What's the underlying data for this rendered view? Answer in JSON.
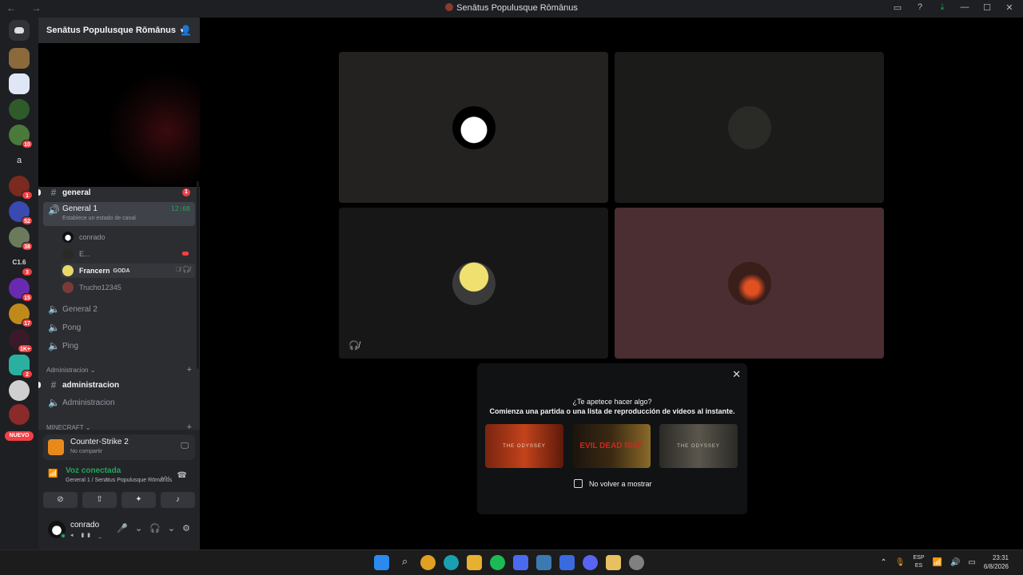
{
  "window": {
    "title": "Senātus Populusque Rōmānus",
    "nav": "← →",
    "controls": [
      "inbox-icon",
      "help-icon",
      "download-icon",
      "minimize-icon",
      "maximize-icon",
      "close-icon"
    ]
  },
  "servers": {
    "badges": [
      "10",
      "1",
      "52",
      "38",
      "3",
      "15",
      "17",
      "1K+",
      "2"
    ],
    "text_icons": [
      "a",
      "C1.6"
    ],
    "new_label": "NUEVO"
  },
  "guild": {
    "name": "Senātus Populusque Rōmānus",
    "channels": {
      "general": {
        "name": "general",
        "mentions": "1"
      },
      "voice_active": {
        "name": "General 1",
        "time": "12:08",
        "status": "Establece un estado de canal"
      },
      "voice_users": [
        {
          "name": "conrado"
        },
        {
          "name": "E..."
        },
        {
          "name": "Francern",
          "tag": "GODA"
        },
        {
          "name": "Trucho12345"
        }
      ],
      "general2": "General 2",
      "pong": "Pong",
      "ping": "Ping"
    },
    "category_admin": "Administracion",
    "admin_text": "administracion",
    "admin_voice": "Administracion",
    "category_minecraft": "MINECRAFT"
  },
  "activity": {
    "game": "Counter-Strike 2",
    "sub": "No compartir"
  },
  "voice_panel": {
    "title": "Voz conectada",
    "sub": "General 1 / Senātus Populusque Rōmānus"
  },
  "user": {
    "name": "conrado"
  },
  "popup": {
    "question": "¿Te apetece hacer algo?",
    "subtitle": "Comienza una partida o una lista de reproducción de vídeos al instante.",
    "cards": [
      "THE ODYSSEY",
      "EVIL DEAD RISE",
      "THE ODYSSEY"
    ],
    "checkbox_label": "No volver a mostrar"
  },
  "taskbar": {
    "lang_top": "ESP",
    "lang_bottom": "ES",
    "time": "23:31",
    "date": "6/8/2026"
  },
  "colors": {
    "accent_green": "#23a55a",
    "badge_red": "#f23f43",
    "tile_highlight": "#4a2e31"
  }
}
